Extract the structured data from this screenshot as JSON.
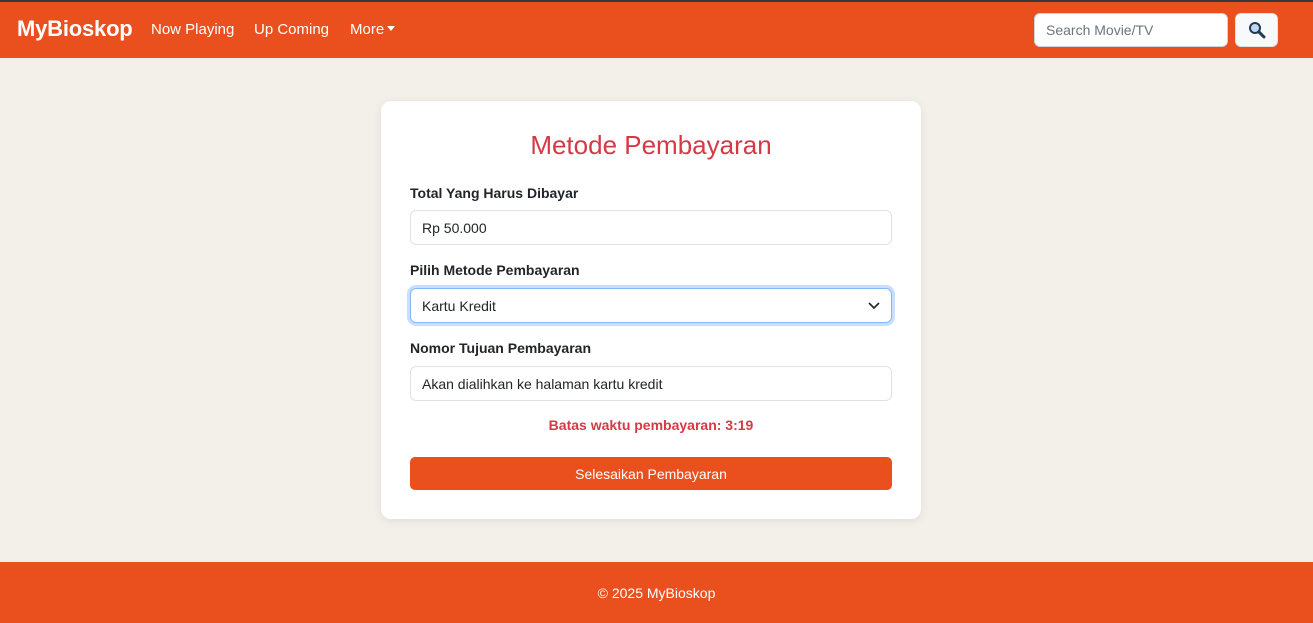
{
  "navbar": {
    "brand": "MyBioskop",
    "links": [
      {
        "label": "Now Playing"
      },
      {
        "label": "Up Coming"
      },
      {
        "label": "More"
      }
    ],
    "search": {
      "placeholder": "Search Movie/TV",
      "value": ""
    },
    "search_icon": "magnifying-glass-icon"
  },
  "payment": {
    "title": "Metode Pembayaran",
    "total_label": "Total Yang Harus Dibayar",
    "total_value": "Rp 50.000",
    "method_label": "Pilih Metode Pembayaran",
    "method_value": "Kartu Kredit",
    "destination_label": "Nomor Tujuan Pembayaran",
    "destination_value": "Akan dialihkan ke halaman kartu kredit",
    "timer_text": "Batas waktu pembayaran: 3:19",
    "submit_label": "Selesaikan Pembayaran"
  },
  "footer": {
    "text": "© 2025 MyBioskop"
  },
  "colors": {
    "brand": "#e9501e",
    "title": "#d63946",
    "background": "#f3f0ea"
  }
}
